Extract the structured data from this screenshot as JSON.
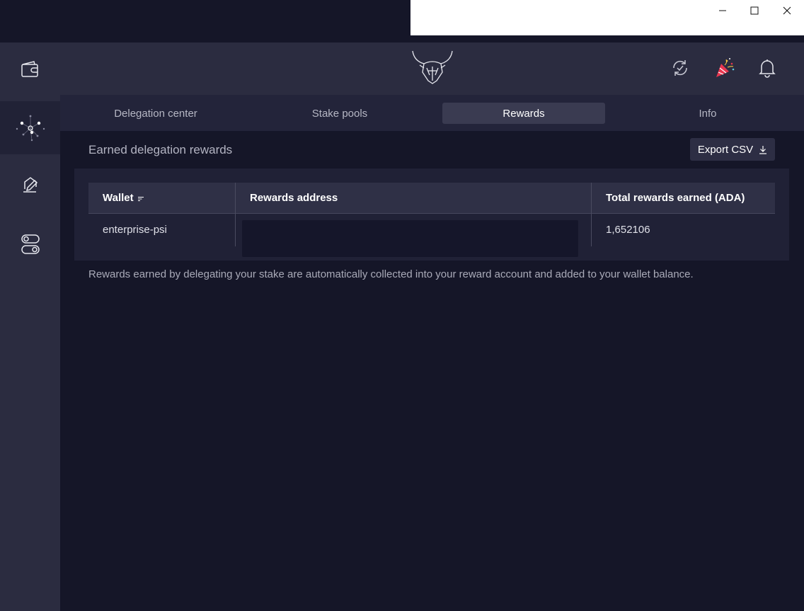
{
  "header": {
    "logo": "bull-head-logo",
    "icons": [
      "sync-check-icon",
      "party-popper-icon",
      "bell-icon"
    ]
  },
  "sidebar": {
    "items": [
      {
        "name": "wallet-icon",
        "active": false
      },
      {
        "name": "delegation-network-icon",
        "active": true
      },
      {
        "name": "sign-document-icon",
        "active": false
      },
      {
        "name": "settings-toggle-icon",
        "active": false
      }
    ]
  },
  "tabs": [
    {
      "label": "Delegation center",
      "active": false
    },
    {
      "label": "Stake pools",
      "active": false
    },
    {
      "label": "Rewards",
      "active": true
    },
    {
      "label": "Info",
      "active": false
    }
  ],
  "rewards": {
    "title": "Earned delegation rewards",
    "export_label": "Export CSV",
    "table": {
      "columns": [
        "Wallet",
        "Rewards address",
        "Total rewards earned (ADA)"
      ],
      "rows": [
        {
          "wallet": "enterprise-psi",
          "address": "",
          "total": "1,652106"
        }
      ]
    },
    "note": "Rewards earned by delegating your stake are automatically collected into your reward account and added to your wallet balance."
  },
  "colors": {
    "background": "#151628",
    "sidebar": "#2b2c40",
    "active_tab": "#3a3b51",
    "accent_red": "#e8364f"
  }
}
